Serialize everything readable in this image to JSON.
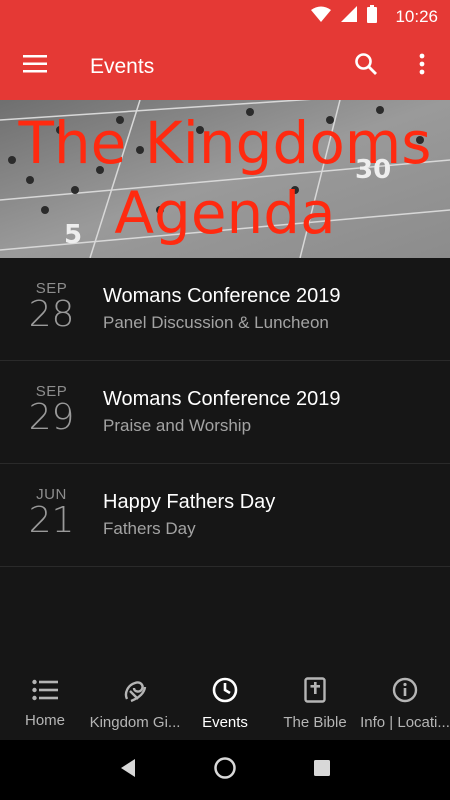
{
  "status_bar": {
    "time": "10:26"
  },
  "app_bar": {
    "title": "Events"
  },
  "banner": {
    "title_line1": "The Kingdoms",
    "title_line2": "Agenda"
  },
  "events": [
    {
      "month": "SEP",
      "day": "28",
      "title": "Womans Conference 2019",
      "subtitle": "Panel Discussion & Luncheon"
    },
    {
      "month": "SEP",
      "day": "29",
      "title": "Womans Conference 2019",
      "subtitle": "Praise and Worship"
    },
    {
      "month": "JUN",
      "day": "21",
      "title": "Happy Fathers Day",
      "subtitle": "Fathers Day"
    }
  ],
  "bottom_nav": [
    {
      "label": "Home",
      "icon": "list-icon"
    },
    {
      "label": "Kingdom Gi...",
      "icon": "giving-icon"
    },
    {
      "label": "Events",
      "icon": "clock-icon",
      "active": true
    },
    {
      "label": "The Bible",
      "icon": "bible-icon"
    },
    {
      "label": "Info | Locati...",
      "icon": "info-icon"
    }
  ],
  "colors": {
    "primary": "#e53935",
    "background": "#161616",
    "banner_text": "#ff2a10"
  }
}
